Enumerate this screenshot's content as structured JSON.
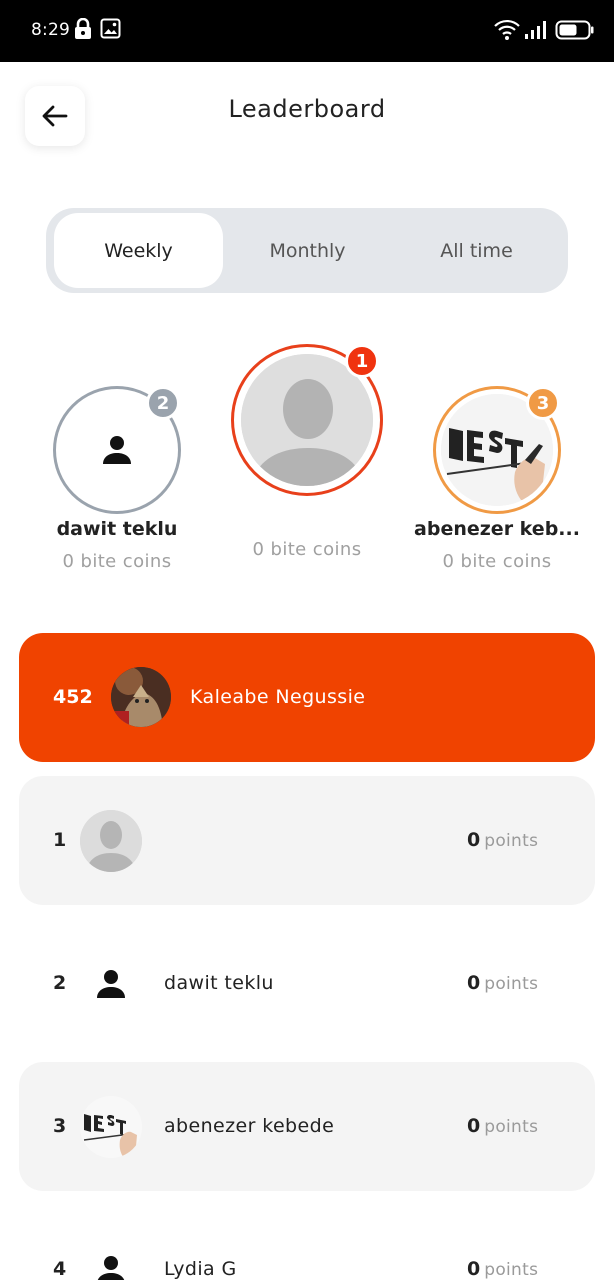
{
  "status_bar": {
    "time": "8:29",
    "icons": [
      "lock-icon",
      "image-icon",
      "wifi-icon",
      "signal-icon",
      "battery-icon"
    ]
  },
  "header": {
    "back_icon": "arrow-left-icon",
    "title": "Leaderboard"
  },
  "tabs": [
    {
      "label": "Weekly",
      "active": true
    },
    {
      "label": "Monthly",
      "active": false
    },
    {
      "label": "All time",
      "active": false
    }
  ],
  "podium": {
    "first": {
      "rank": "1",
      "name": "",
      "coins": "0 bite coins"
    },
    "second": {
      "rank": "2",
      "name": "dawit teklu",
      "coins": "0 bite coins"
    },
    "third": {
      "rank": "3",
      "name": "abenezer keb...",
      "coins": "0 bite coins"
    }
  },
  "current_user": {
    "score": "452",
    "name": "Kaleabe Negussie"
  },
  "leaderboard": [
    {
      "rank": "1",
      "name": "",
      "points": "0",
      "points_label": "points"
    },
    {
      "rank": "2",
      "name": "dawit teklu",
      "points": "0",
      "points_label": "points"
    },
    {
      "rank": "3",
      "name": "abenezer kebede",
      "points": "0",
      "points_label": "points"
    },
    {
      "rank": "4",
      "name": "Lydia G",
      "points": "0",
      "points_label": "points"
    }
  ],
  "colors": {
    "accent": "#f04300",
    "first_place": "#f0330f",
    "second_place": "#9aa3ad",
    "third_place": "#f09a45"
  }
}
